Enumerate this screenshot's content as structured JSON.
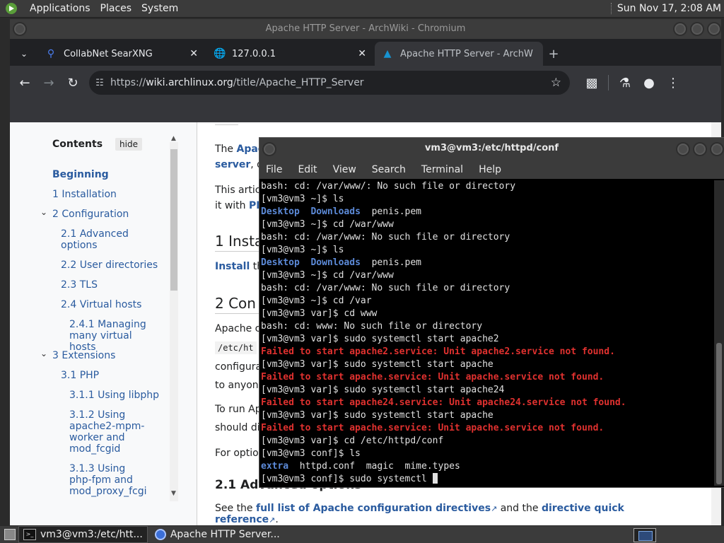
{
  "top_panel": {
    "menus": [
      "Applications",
      "Places",
      "System"
    ],
    "clock": "Sun Nov 17,  2:08 AM"
  },
  "browser": {
    "title": "Apache HTTP Server - ArchWiki - Chromium",
    "tabs": [
      {
        "label": "CollabNet SearXNG",
        "icon": "search-icon"
      },
      {
        "label": "127.0.0.1",
        "icon": "globe-icon"
      },
      {
        "label": "Apache HTTP Server - ArchW",
        "icon": "archlinux-icon"
      }
    ],
    "new_tab": "+",
    "url_prefix": "https://",
    "url_host": "wiki.archlinux.org",
    "url_path": "/title/Apache_HTTP_Server"
  },
  "toc": {
    "title": "Contents",
    "hide": "hide",
    "items": [
      "Beginning",
      "1  Installation",
      "2  Configuration",
      "2.1  Advanced options",
      "2.2  User directories",
      "2.3  TLS",
      "2.4  Virtual hosts",
      "2.4.1  Managing many virtual hosts",
      "3  Extensions",
      "3.1  PHP",
      "3.1.1  Using libphp",
      "3.1.2  Using apache2-mpm-worker and mod_fcgid",
      "3.1.3  Using php-fpm and mod_proxy_fcgi"
    ]
  },
  "article": {
    "p1_a": "The ",
    "p1_link": "Apac",
    "p1_b": "server",
    "p1_c": ", de",
    "p2_a": "This articl",
    "p2_b": "it with ",
    "p2_link": "PHP",
    "h1": "1  Insta",
    "p3_link": "Install",
    "p3_b": " the",
    "h2": "2  Con",
    "p4": "Apache co",
    "p4_code": "/etc/ht",
    "p4_b": "configurat",
    "p4_c": "to anyone",
    "p5": "To run Apa",
    "p5_b": "should dis",
    "p6": "For option",
    "h3": "2.1  Advanced options",
    "last_a": "See the ",
    "last_link1": "full list of Apache configuration directives",
    "last_b": " and the ",
    "last_link2": "directive quick reference",
    "last_c": "."
  },
  "terminal": {
    "title": "vm3@vm3:/etc/httpd/conf",
    "menus": [
      "File",
      "Edit",
      "View",
      "Search",
      "Terminal",
      "Help"
    ],
    "lines": [
      {
        "t": "bash: cd: /var/www/: No such file or directory",
        "c": "n"
      },
      {
        "t": "[vm3@vm3 ~]$ ls",
        "c": "n"
      },
      {
        "t": "",
        "c": "ls1"
      },
      {
        "t": "[vm3@vm3 ~]$ cd /war/www",
        "c": "n"
      },
      {
        "t": "bash: cd: /war/www: No such file or directory",
        "c": "n"
      },
      {
        "t": "[vm3@vm3 ~]$ ls",
        "c": "n"
      },
      {
        "t": "",
        "c": "ls1"
      },
      {
        "t": "[vm3@vm3 ~]$ cd /var/www",
        "c": "n"
      },
      {
        "t": "bash: cd: /var/www: No such file or directory",
        "c": "n"
      },
      {
        "t": "[vm3@vm3 ~]$ cd /var",
        "c": "n"
      },
      {
        "t": "[vm3@vm3 var]$ cd www",
        "c": "n"
      },
      {
        "t": "bash: cd: www: No such file or directory",
        "c": "n"
      },
      {
        "t": "[vm3@vm3 var]$ sudo systemctl start apache2",
        "c": "n"
      },
      {
        "t": "Failed to start apache2.service: Unit apache2.service not found.",
        "c": "err"
      },
      {
        "t": "[vm3@vm3 var]$ sudo systemctl start apache",
        "c": "n"
      },
      {
        "t": "Failed to start apache.service: Unit apache.service not found.",
        "c": "err"
      },
      {
        "t": "[vm3@vm3 var]$ sudo systemctl start apache24",
        "c": "n"
      },
      {
        "t": "Failed to start apache24.service: Unit apache24.service not found.",
        "c": "err"
      },
      {
        "t": "[vm3@vm3 var]$ sudo systemctl start apache",
        "c": "n"
      },
      {
        "t": "Failed to start apache.service: Unit apache.service not found.",
        "c": "err"
      },
      {
        "t": "[vm3@vm3 var]$ cd /etc/httpd/conf",
        "c": "n"
      },
      {
        "t": "[vm3@vm3 conf]$ ls",
        "c": "n"
      },
      {
        "t": "",
        "c": "ls2"
      },
      {
        "t": "[vm3@vm3 conf]$ sudo systemctl ",
        "c": "prompt"
      }
    ],
    "ls_home": {
      "dirs": [
        "Desktop",
        "Downloads"
      ],
      "files": [
        "penis.pem"
      ]
    },
    "ls_conf": {
      "dirs": [
        "extra"
      ],
      "files": [
        "httpd.conf",
        "magic",
        "mime.types"
      ]
    }
  },
  "taskbar": {
    "items": [
      {
        "label": "vm3@vm3:/etc/htt...",
        "icon": "terminal-icon"
      },
      {
        "label": "Apache HTTP Server...",
        "icon": "chromium-icon"
      }
    ]
  }
}
